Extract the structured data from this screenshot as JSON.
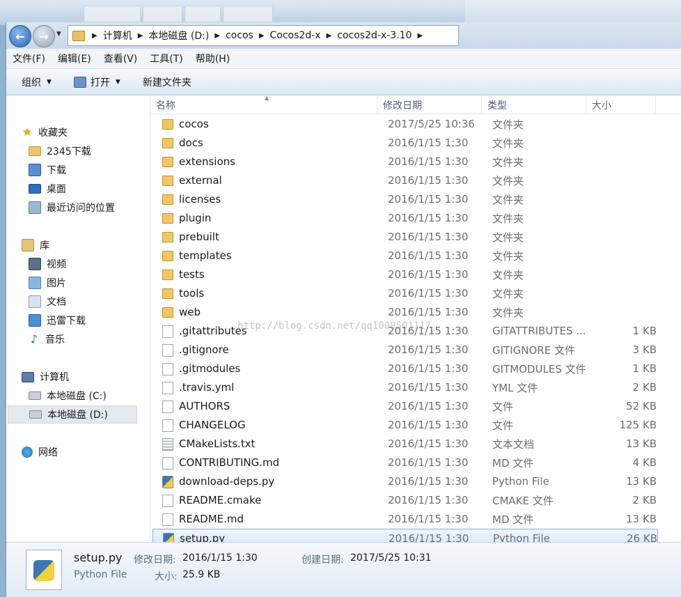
{
  "address": {
    "crumbs": [
      "计算机",
      "本地磁盘 (D:)",
      "cocos",
      "Cocos2d-x",
      "cocos2d-x-3.10"
    ]
  },
  "menu": [
    "文件(F)",
    "编辑(E)",
    "查看(V)",
    "工具(T)",
    "帮助(H)"
  ],
  "toolbar": {
    "organize": "组织",
    "open": "打开",
    "new_folder": "新建文件夹"
  },
  "nav": {
    "favorites": {
      "label": "收藏夹",
      "items": [
        "2345下载",
        "下载",
        "桌面",
        "最近访问的位置"
      ]
    },
    "libraries": {
      "label": "库",
      "items": [
        "视频",
        "图片",
        "文档",
        "迅雷下载",
        "音乐"
      ]
    },
    "computer": {
      "label": "计算机",
      "items": [
        "本地磁盘 (C:)",
        "本地磁盘 (D:)"
      ]
    },
    "network": "网络"
  },
  "columns": {
    "name": "名称",
    "date": "修改日期",
    "type": "类型",
    "size": "大小"
  },
  "files": [
    {
      "name": "cocos",
      "date": "2017/5/25 10:36",
      "type": "文件夹",
      "size": "",
      "icon": "folder"
    },
    {
      "name": "docs",
      "date": "2016/1/15 1:30",
      "type": "文件夹",
      "size": "",
      "icon": "folder"
    },
    {
      "name": "extensions",
      "date": "2016/1/15 1:30",
      "type": "文件夹",
      "size": "",
      "icon": "folder"
    },
    {
      "name": "external",
      "date": "2016/1/15 1:30",
      "type": "文件夹",
      "size": "",
      "icon": "folder"
    },
    {
      "name": "licenses",
      "date": "2016/1/15 1:30",
      "type": "文件夹",
      "size": "",
      "icon": "folder"
    },
    {
      "name": "plugin",
      "date": "2016/1/15 1:30",
      "type": "文件夹",
      "size": "",
      "icon": "folder"
    },
    {
      "name": "prebuilt",
      "date": "2016/1/15 1:30",
      "type": "文件夹",
      "size": "",
      "icon": "folder"
    },
    {
      "name": "templates",
      "date": "2016/1/15 1:30",
      "type": "文件夹",
      "size": "",
      "icon": "folder"
    },
    {
      "name": "tests",
      "date": "2016/1/15 1:30",
      "type": "文件夹",
      "size": "",
      "icon": "folder"
    },
    {
      "name": "tools",
      "date": "2016/1/15 1:30",
      "type": "文件夹",
      "size": "",
      "icon": "folder"
    },
    {
      "name": "web",
      "date": "2016/1/15 1:30",
      "type": "文件夹",
      "size": "",
      "icon": "folder"
    },
    {
      "name": ".gitattributes",
      "date": "2016/1/15 1:30",
      "type": "GITATTRIBUTES ...",
      "size": "1 KB",
      "icon": "file"
    },
    {
      "name": ".gitignore",
      "date": "2016/1/15 1:30",
      "type": "GITIGNORE 文件",
      "size": "3 KB",
      "icon": "file"
    },
    {
      "name": ".gitmodules",
      "date": "2016/1/15 1:30",
      "type": "GITMODULES 文件",
      "size": "1 KB",
      "icon": "file"
    },
    {
      "name": ".travis.yml",
      "date": "2016/1/15 1:30",
      "type": "YML 文件",
      "size": "2 KB",
      "icon": "file"
    },
    {
      "name": "AUTHORS",
      "date": "2016/1/15 1:30",
      "type": "文件",
      "size": "52 KB",
      "icon": "file"
    },
    {
      "name": "CHANGELOG",
      "date": "2016/1/15 1:30",
      "type": "文件",
      "size": "125 KB",
      "icon": "file"
    },
    {
      "name": "CMakeLists.txt",
      "date": "2016/1/15 1:30",
      "type": "文本文档",
      "size": "13 KB",
      "icon": "text"
    },
    {
      "name": "CONTRIBUTING.md",
      "date": "2016/1/15 1:30",
      "type": "MD 文件",
      "size": "4 KB",
      "icon": "file"
    },
    {
      "name": "download-deps.py",
      "date": "2016/1/15 1:30",
      "type": "Python File",
      "size": "13 KB",
      "icon": "python"
    },
    {
      "name": "README.cmake",
      "date": "2016/1/15 1:30",
      "type": "CMAKE 文件",
      "size": "2 KB",
      "icon": "file"
    },
    {
      "name": "README.md",
      "date": "2016/1/15 1:30",
      "type": "MD 文件",
      "size": "13 KB",
      "icon": "file"
    },
    {
      "name": "setup.py",
      "date": "2016/1/15 1:30",
      "type": "Python File",
      "size": "26 KB",
      "icon": "python",
      "selected": true
    }
  ],
  "watermark": "http://blog.csdn.net/qq1009501117",
  "details": {
    "name": "setup.py",
    "type": "Python File",
    "modified_label": "修改日期:",
    "modified": "2016/1/15 1:30",
    "created_label": "创建日期:",
    "created": "2017/5/25 10:31",
    "size_label": "大小:",
    "size": "25.9 KB"
  }
}
